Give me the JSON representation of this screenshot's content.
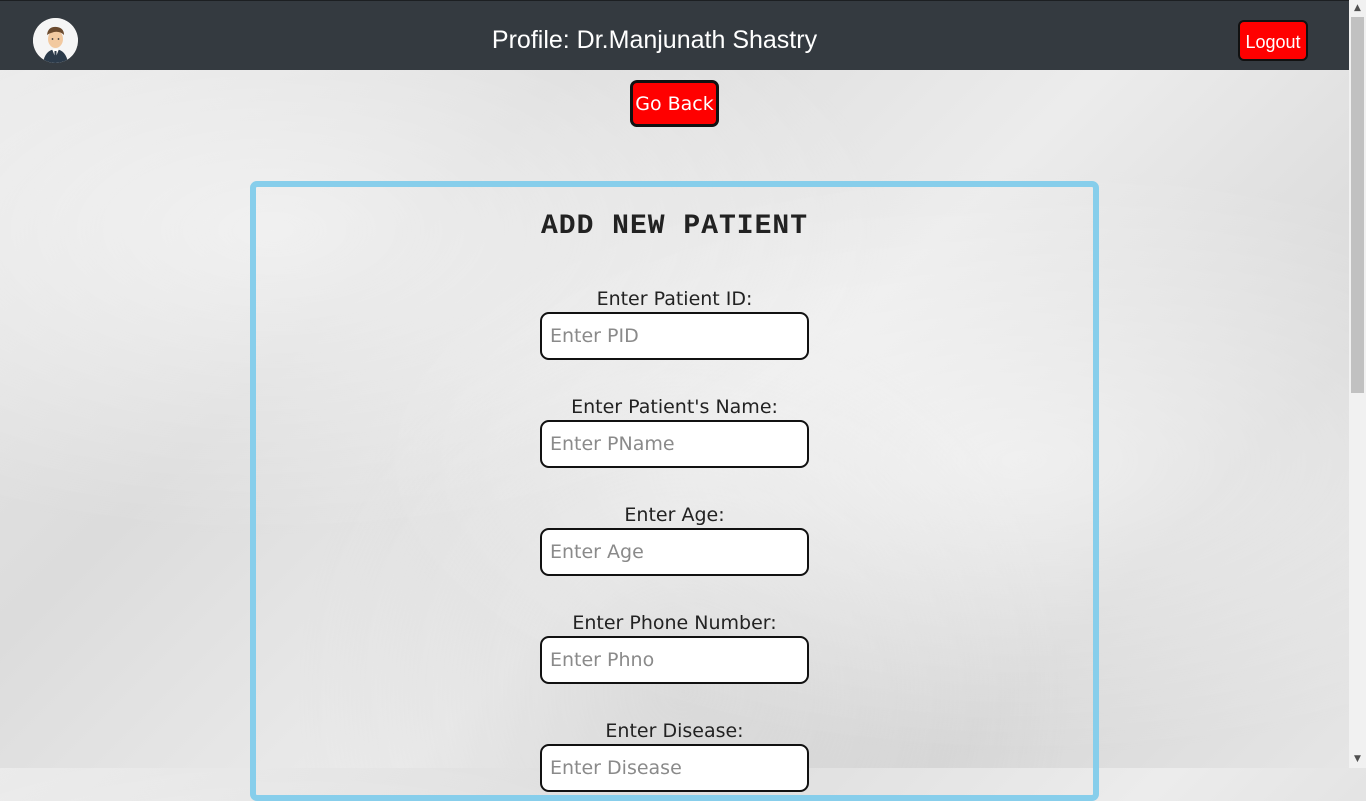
{
  "header": {
    "title": "Profile: Dr.Manjunath Shastry",
    "logout_label": "Logout",
    "avatar_icon": "doctor-avatar-icon"
  },
  "go_back_label": "Go Back",
  "form": {
    "title": "ADD NEW PATIENT",
    "fields": [
      {
        "label": "Enter Patient ID:",
        "placeholder": "Enter PID",
        "value": ""
      },
      {
        "label": "Enter Patient's Name:",
        "placeholder": "Enter PName",
        "value": ""
      },
      {
        "label": "Enter Age:",
        "placeholder": "Enter Age",
        "value": ""
      },
      {
        "label": "Enter Phone Number:",
        "placeholder": "Enter Phno",
        "value": ""
      },
      {
        "label": "Enter Disease:",
        "placeholder": "Enter Disease",
        "value": ""
      }
    ]
  },
  "colors": {
    "navbar": "#343a40",
    "button_red": "#ff0000",
    "card_border": "#87ceeb"
  },
  "scrollbar": {
    "up_icon": "scroll-up-arrow-icon",
    "down_icon": "scroll-down-arrow-icon"
  }
}
